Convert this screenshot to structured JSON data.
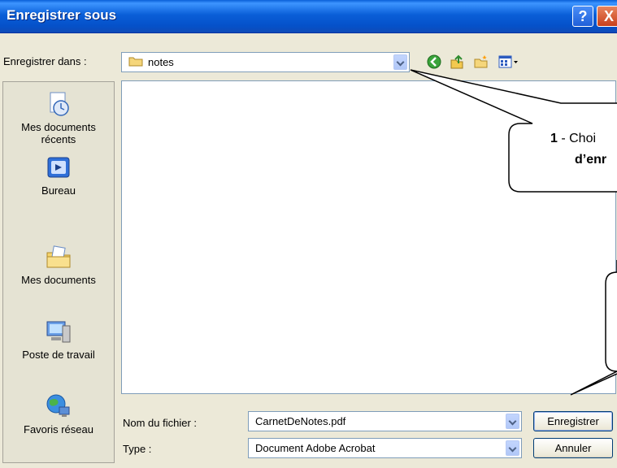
{
  "window": {
    "title": "Enregistrer sous",
    "help_label": "?",
    "close_label": "X"
  },
  "save_in": {
    "label": "Enregistrer dans :",
    "value": "notes"
  },
  "places": [
    {
      "line1": "Mes documents",
      "line2": "récents",
      "icon": "recent-documents-icon"
    },
    {
      "line1": "Bureau",
      "line2": "",
      "icon": "desktop-icon"
    },
    {
      "line1": "Mes documents",
      "line2": "",
      "icon": "my-documents-icon"
    },
    {
      "line1": "Poste de travail",
      "line2": "",
      "icon": "my-computer-icon"
    },
    {
      "line1": "Favoris réseau",
      "line2": "",
      "icon": "network-places-icon"
    }
  ],
  "filename": {
    "label": "Nom du fichier :",
    "value": "CarnetDeNotes.pdf"
  },
  "filetype": {
    "label": "Type :",
    "value": "Document Adobe Acrobat"
  },
  "buttons": {
    "save": "Enregistrer",
    "cancel": "Annuler"
  },
  "callout1": {
    "num": "1",
    "line1_rest": " - Choi",
    "line2": "d’enr"
  },
  "colors": {
    "titlebar": "#0a5fd8",
    "dialog_bg": "#ece9d8",
    "field_border": "#7f9db9"
  }
}
